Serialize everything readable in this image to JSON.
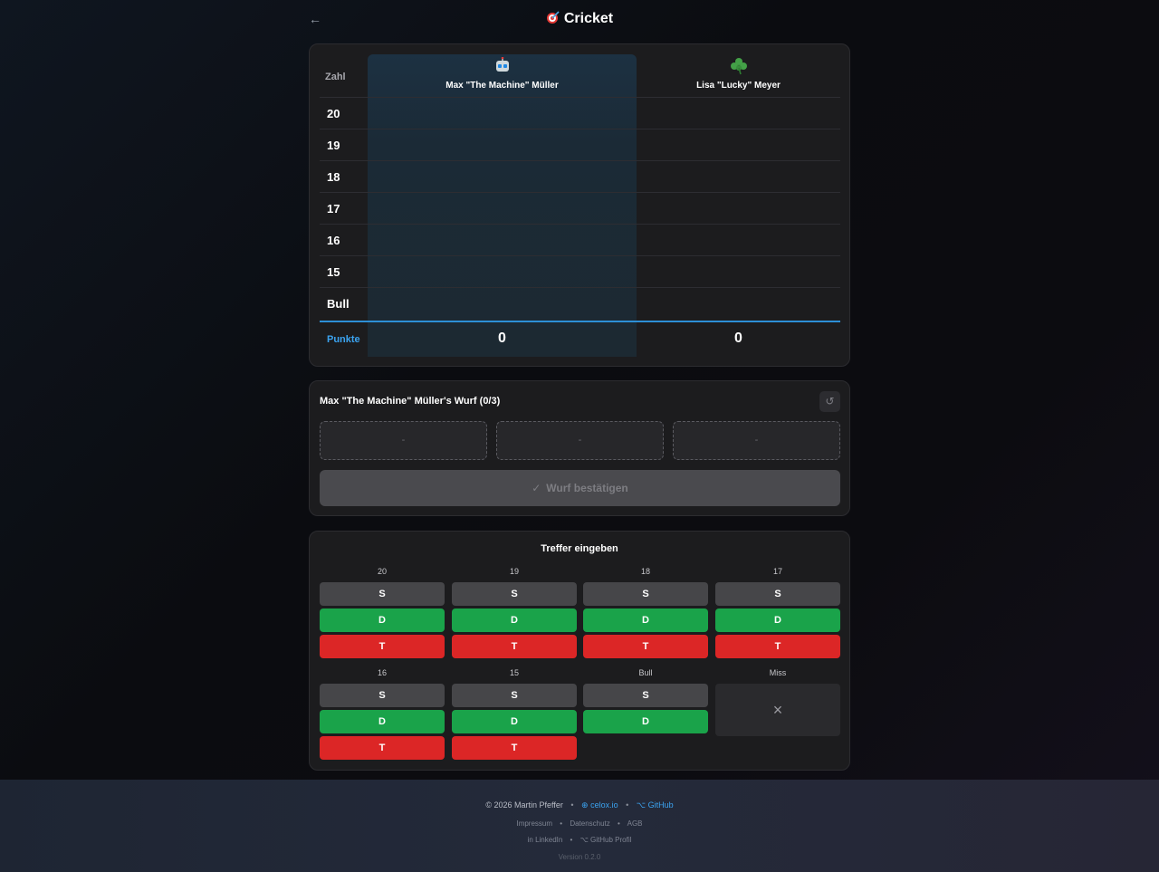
{
  "header": {
    "title": "Cricket"
  },
  "scoreboard": {
    "column_label": "Zahl",
    "players": [
      {
        "name": "Max \"The Machine\" Müller",
        "icon": "robot-icon",
        "points": "0"
      },
      {
        "name": "Lisa \"Lucky\" Meyer",
        "icon": "clover-icon",
        "points": "0"
      }
    ],
    "rows": [
      "20",
      "19",
      "18",
      "17",
      "16",
      "15",
      "Bull"
    ],
    "points_label": "Punkte",
    "accent_color": "#3ba3f0"
  },
  "throw": {
    "title": "Max \"The Machine\" Müller's Wurf (0/3)",
    "slots": [
      "-",
      "-",
      "-"
    ],
    "confirm_label": "Wurf bestätigen"
  },
  "hits": {
    "title": "Treffer eingeben",
    "groups": [
      {
        "label": "20",
        "buttons": [
          "S",
          "D",
          "T"
        ]
      },
      {
        "label": "19",
        "buttons": [
          "S",
          "D",
          "T"
        ]
      },
      {
        "label": "18",
        "buttons": [
          "S",
          "D",
          "T"
        ]
      },
      {
        "label": "17",
        "buttons": [
          "S",
          "D",
          "T"
        ]
      },
      {
        "label": "16",
        "buttons": [
          "S",
          "D",
          "T"
        ]
      },
      {
        "label": "15",
        "buttons": [
          "S",
          "D",
          "T"
        ]
      },
      {
        "label": "Bull",
        "buttons": [
          "S",
          "D"
        ]
      },
      {
        "label": "Miss",
        "buttons": [
          "×"
        ]
      }
    ],
    "colors": {
      "single": "#464649",
      "double": "#1aa34a",
      "triple": "#dc2626"
    }
  },
  "footer": {
    "copyright": "© 2026 Martin Pfeffer",
    "site_link": "celox.io",
    "github_link": "GitHub",
    "legal": [
      "Impressum",
      "Datenschutz",
      "AGB"
    ],
    "social": [
      "LinkedIn",
      "GitHub Profil"
    ],
    "version": "Version 0.2.0"
  }
}
